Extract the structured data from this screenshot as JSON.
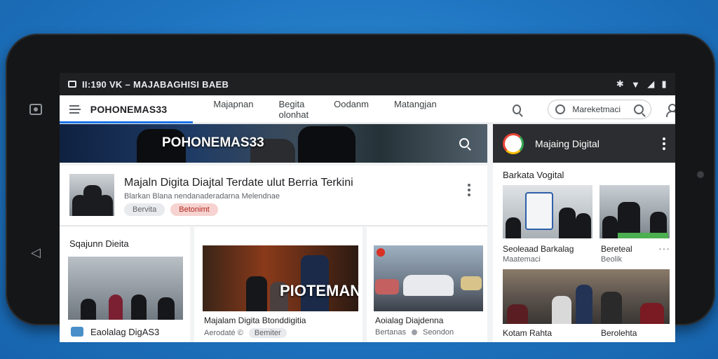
{
  "status_bar": {
    "left_text": "II:190  VK – MAJABAGHISI BAEB",
    "right_icons": [
      "bluetooth-icon",
      "wifi-icon",
      "signal-icon",
      "battery-icon"
    ]
  },
  "top_bar": {
    "brand": "POHONEMAS33",
    "tabs": [
      "Majapnan",
      "Begita olonhat",
      "Oodanm",
      "Matangjan"
    ],
    "search_pill_text": "Mareketmaci"
  },
  "hero": {
    "title": "POHONEMAS33"
  },
  "side_header": {
    "title": "Majaing Digital"
  },
  "feature": {
    "headline": "Majaln Digita Diajtal Terdate ulut Berria Terkini",
    "subline": "Blarkan Blana nendanaderadarna Melendnae",
    "chips": [
      "Bervita",
      "Betonimt"
    ]
  },
  "cards": [
    {
      "heading": "Sqajunn Dieita",
      "title": "Eaolalag DigAS3"
    },
    {
      "banner": "PIOTEMANI",
      "title": "Majalam Digita Btonddigitia",
      "meta": "Aerodaté ©",
      "chip": "Bemiter"
    },
    {
      "title": "Aoialag Diajdenna",
      "meta": "Bertanas",
      "meta2": "Seondon"
    }
  ],
  "side_panel": {
    "title": "Barkata Vogital",
    "items": [
      {
        "caption": "Seoleaad Barkalag",
        "sub": "Maatemaci"
      },
      {
        "caption": "Bereteal",
        "sub": "Beolik"
      },
      {
        "caption": "Kotam Rahta",
        "sub": ""
      },
      {
        "caption": "Berolehta",
        "sub": ""
      }
    ]
  }
}
